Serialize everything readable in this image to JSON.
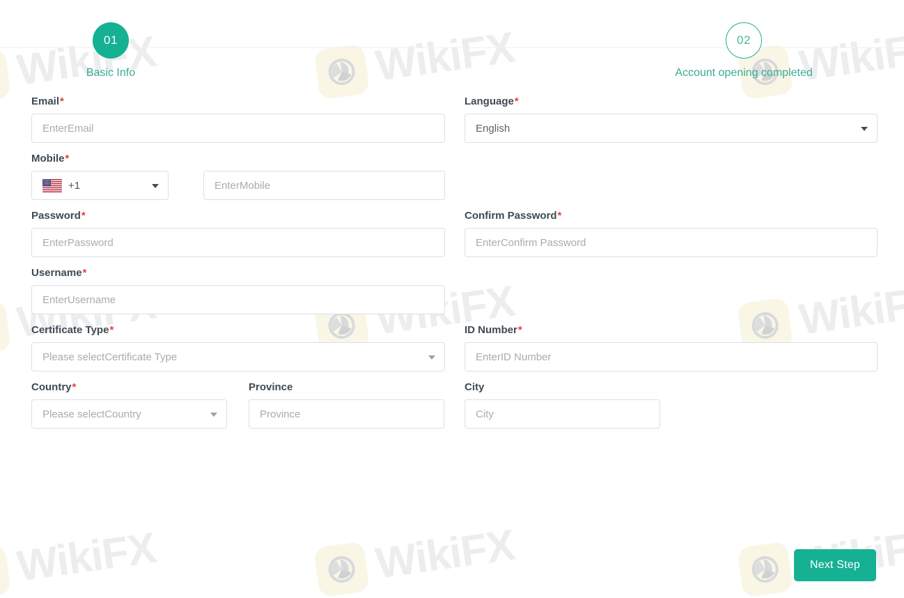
{
  "brand": {
    "watermark_text": "WikiFX",
    "accent_color": "#16b093",
    "required_color": "#ea3c3c"
  },
  "stepper": {
    "steps": [
      {
        "number": "01",
        "label": "Basic Info",
        "state": "active"
      },
      {
        "number": "02",
        "label": "Account opening completed",
        "state": "inactive"
      }
    ]
  },
  "form": {
    "email": {
      "label": "Email",
      "required": "*",
      "placeholder": "EnterEmail",
      "value": ""
    },
    "language": {
      "label": "Language",
      "required": "*",
      "value": "English"
    },
    "mobile": {
      "label": "Mobile",
      "required": "*",
      "country_code": "+1",
      "country_flag": "us-flag-icon",
      "placeholder": "EnterMobile",
      "value": ""
    },
    "password": {
      "label": "Password",
      "required": "*",
      "placeholder": "EnterPassword",
      "value": ""
    },
    "confirm_password": {
      "label": "Confirm Password",
      "required": "*",
      "placeholder": "EnterConfirm Password",
      "value": ""
    },
    "username": {
      "label": "Username",
      "required": "*",
      "placeholder": "EnterUsername",
      "value": ""
    },
    "certificate_type": {
      "label": "Certificate Type",
      "required": "*",
      "placeholder": "Please selectCertificate Type",
      "value": ""
    },
    "id_number": {
      "label": "ID Number",
      "required": "*",
      "placeholder": "EnterID Number",
      "value": ""
    },
    "country": {
      "label": "Country",
      "required": "*",
      "placeholder": "Please selectCountry",
      "value": ""
    },
    "province": {
      "label": "Province",
      "required": "",
      "placeholder": "Province",
      "value": ""
    },
    "city": {
      "label": "City",
      "required": "",
      "placeholder": "City",
      "value": ""
    }
  },
  "footer": {
    "next_label": "Next Step"
  }
}
